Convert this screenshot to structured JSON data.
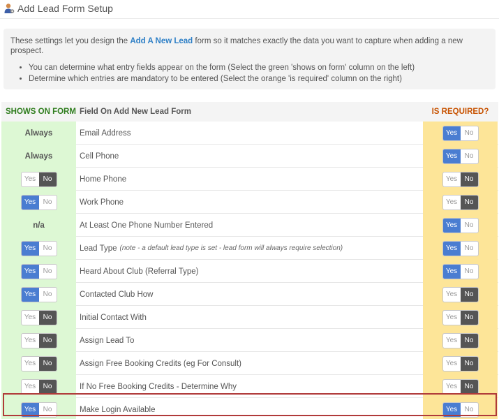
{
  "header": {
    "title": "Add Lead Form Setup",
    "icon": "user-settings-icon"
  },
  "info": {
    "intro_before": "These settings let you design the ",
    "intro_link": "Add A New Lead",
    "intro_after": " form so it matches exactly the data you want to capture when adding a new prospect.",
    "bullets": [
      "You can determine what entry fields appear on the form (Select the green 'shows on form' column on the left)",
      "Determine which entries are mandatory to be entered (Select the orange 'is required' column on the right)"
    ]
  },
  "table": {
    "col_shows": "SHOWS ON FORM",
    "col_field": "Field On Add New Lead Form",
    "col_required": "IS REQUIRED?",
    "yes_label": "Yes",
    "no_label": "No",
    "rows": [
      {
        "shows": "Always",
        "field": "Email Address",
        "note": "",
        "required": "yes"
      },
      {
        "shows": "Always",
        "field": "Cell Phone",
        "note": "",
        "required": "yes"
      },
      {
        "shows": "no",
        "field": "Home Phone",
        "note": "",
        "required": "no"
      },
      {
        "shows": "yes",
        "field": "Work Phone",
        "note": "",
        "required": "no"
      },
      {
        "shows": "n/a",
        "field": "At Least One Phone Number Entered",
        "note": "",
        "required": "yes"
      },
      {
        "shows": "yes",
        "field": "Lead Type",
        "note": "(note - a default lead type is set - lead form will always require selection)",
        "required": "yes"
      },
      {
        "shows": "yes",
        "field": "Heard About Club (Referral Type)",
        "note": "",
        "required": "yes"
      },
      {
        "shows": "yes",
        "field": "Contacted Club How",
        "note": "",
        "required": "no"
      },
      {
        "shows": "no",
        "field": "Initial Contact With",
        "note": "",
        "required": "no"
      },
      {
        "shows": "no",
        "field": "Assign Lead To",
        "note": "",
        "required": "no"
      },
      {
        "shows": "no",
        "field": "Assign Free Booking Credits (eg For Consult)",
        "note": "",
        "required": "no"
      },
      {
        "shows": "no",
        "field": "If No Free Booking Credits - Determine Why",
        "note": "",
        "required": "no"
      },
      {
        "shows": "yes",
        "field": "Make Login Available",
        "note": "",
        "required": "yes"
      }
    ]
  }
}
